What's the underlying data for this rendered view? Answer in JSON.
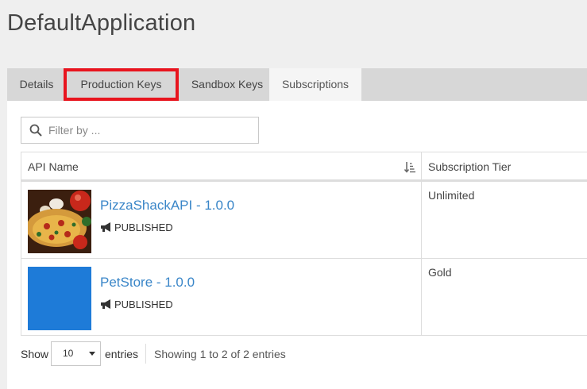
{
  "app": {
    "title": "DefaultApplication"
  },
  "tabs": [
    {
      "label": "Details"
    },
    {
      "label": "Production Keys"
    },
    {
      "label": "Sandbox Keys"
    },
    {
      "label": "Subscriptions"
    }
  ],
  "search": {
    "placeholder": "Filter by ...",
    "value": ""
  },
  "table": {
    "columns": [
      "API Name",
      "Subscription Tier"
    ],
    "rows": [
      {
        "name": "PizzaShackAPI - 1.0.0",
        "status": "PUBLISHED",
        "tier": "Unlimited",
        "thumb": "pizza-image"
      },
      {
        "name": "PetStore - 1.0.0",
        "status": "PUBLISHED",
        "tier": "Gold",
        "thumb": "blue-placeholder"
      }
    ]
  },
  "footer": {
    "show_label": "Show",
    "page_size": "10",
    "entries_label": "entries",
    "info": "Showing 1 to 2 of 2 entries"
  },
  "colors": {
    "link": "#3a86c8",
    "highlight": "#e8141e",
    "tab_bar": "#d7d7d7",
    "petstore_thumb": "#1e7bd8"
  }
}
